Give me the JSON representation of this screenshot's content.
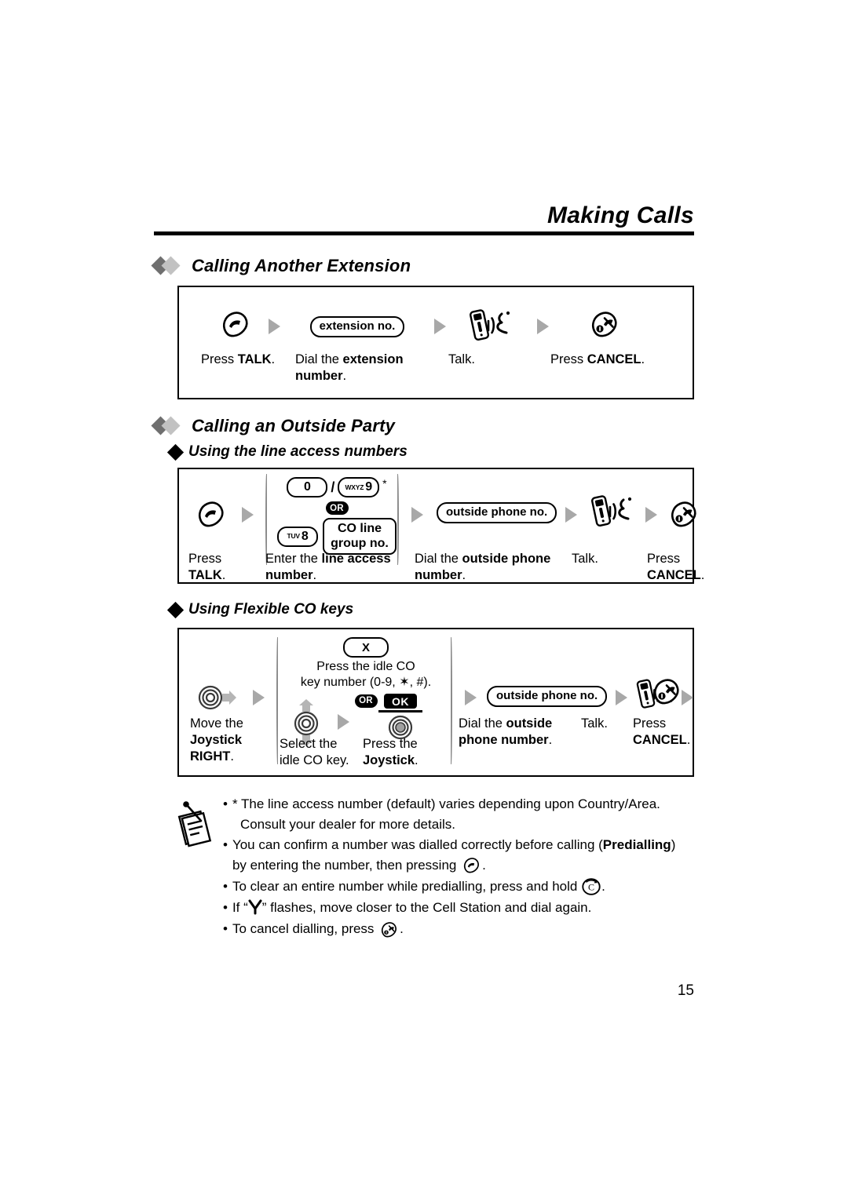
{
  "header": {
    "title": "Making Calls"
  },
  "page_number": "15",
  "sections": [
    {
      "heading": "Calling Another Extension",
      "steps": [
        {
          "icon": "talk-key-icon",
          "caption_plain": "Press ",
          "caption_bold": "TALK",
          "caption_tail": "."
        },
        {
          "icon": "extension-no-pill",
          "label": "extension no.",
          "caption_plain": "Dial the ",
          "caption_bold": "extension number",
          "caption_tail": "."
        },
        {
          "icon": "talking-handset-icon",
          "caption_plain": "Talk.",
          "caption_bold": "",
          "caption_tail": ""
        },
        {
          "icon": "cancel-key-icon",
          "caption_plain": "Press ",
          "caption_bold": "CANCEL",
          "caption_tail": "."
        }
      ]
    },
    {
      "heading": "Calling an Outside Party",
      "subheading": "Using the line access numbers",
      "keys": {
        "key_zero": "0",
        "slash": "/",
        "key_nine_letters": "WXYZ",
        "key_nine_num": "9",
        "asterisk": "*",
        "or": "OR",
        "key_eight_letters": "TUV",
        "key_eight_num": "8",
        "co_line_line1": "CO line",
        "co_line_line2": "group no."
      },
      "outside_pill": "outside phone no.",
      "captions": {
        "talk_1": "Press",
        "talk_2": "TALK",
        "talk_3": ".",
        "line_1": "Enter the ",
        "line_2": "line access number",
        "line_3": ".",
        "dial_1": "Dial the ",
        "dial_2": "outside phone number",
        "dial_3": ".",
        "talk_label": "Talk.",
        "cancel_1": "Press",
        "cancel_2": "CANCEL",
        "cancel_3": "."
      }
    },
    {
      "subheading": "Using Flexible CO keys",
      "keys": {
        "key_x": "X",
        "press_idle_1": "Press the idle CO",
        "press_idle_2": "key number (0-9, ✶, #).",
        "or": "OR",
        "ok": "OK"
      },
      "outside_pill": "outside phone no.",
      "captions": {
        "move_1": "Move the",
        "move_2": "Joystick RIGHT",
        "move_3": ".",
        "select_1": "Select the",
        "select_2": "idle CO key.",
        "press_1": "Press the",
        "press_2": "Joystick",
        "press_3": ".",
        "dial_1": "Dial the ",
        "dial_2": "outside phone number",
        "dial_3": ".",
        "talk_label": "Talk.",
        "cancel_1": "Press",
        "cancel_2": "CANCEL",
        "cancel_3": "."
      }
    }
  ],
  "notes": {
    "icon": "notepad-pen-icon",
    "items": [
      {
        "bullet": "•",
        "lead": "* The line access number (default) varies depending upon Country/Area.",
        "line2": "Consult your dealer for more details.",
        "bold": "",
        "tail": "",
        "icon_inline": ""
      },
      {
        "bullet": "•",
        "lead": "You can confirm a number was dialled correctly before calling (",
        "bold": "Predialling",
        "tail": ") by entering the number, then pressing ",
        "icon_inline": "talk-key-icon",
        "end": "."
      },
      {
        "bullet": "•",
        "lead": "To clear an entire number while predialling, press and hold ",
        "bold": "",
        "tail": "",
        "icon_inline": "clear-key-icon",
        "end": "."
      },
      {
        "bullet": "•",
        "lead_pre": "If “",
        "icon_inline": "antenna-icon",
        "lead_post": "” flashes, move closer to the Cell Station and dial again.",
        "bold": "",
        "tail": "",
        "end": ""
      },
      {
        "bullet": "•",
        "lead": "To cancel dialling, press ",
        "bold": "",
        "tail": "",
        "icon_inline": "cancel-key-icon",
        "end": "."
      }
    ]
  },
  "colors": {
    "arrow_gray": "#a8a8a8",
    "diamond_dark": "#6f6f6f",
    "diamond_light": "#c2c2c2",
    "ink": "#000000"
  }
}
